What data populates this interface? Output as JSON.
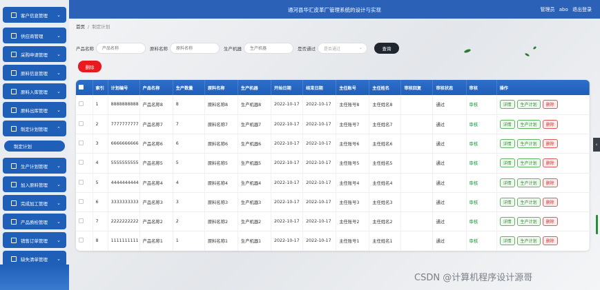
{
  "header": {
    "title": "通河县华汇皮革厂管理系统的设计与实现",
    "user_role": "管理员",
    "user_name": "abo",
    "logout_label": "退出登录"
  },
  "breadcrumb": {
    "home": "首页",
    "current": "制定计划"
  },
  "sidebar": {
    "items": [
      {
        "label": "客户信息管理",
        "icon": "table-icon",
        "expanded": false
      },
      {
        "label": "供应商管理",
        "icon": "user-icon",
        "expanded": false
      },
      {
        "label": "采购申请管理",
        "icon": "grid-icon",
        "expanded": false
      },
      {
        "label": "原料信息管理",
        "icon": "flag-icon",
        "expanded": false
      },
      {
        "label": "原料入库管理",
        "icon": "list-icon",
        "expanded": false
      },
      {
        "label": "原料出库管理",
        "icon": "card-icon",
        "expanded": false
      },
      {
        "label": "制定计划管理",
        "icon": "printer-icon",
        "expanded": true
      },
      {
        "label": "生产计划管理",
        "icon": "chart-icon",
        "expanded": false
      },
      {
        "label": "加入原料管理",
        "icon": "bar-icon",
        "expanded": false
      },
      {
        "label": "完成加工管理",
        "icon": "grid-icon",
        "expanded": false
      },
      {
        "label": "产品质检管理",
        "icon": "box-icon",
        "expanded": false
      },
      {
        "label": "销售订单管理",
        "icon": "grid-icon",
        "expanded": false
      },
      {
        "label": "缺失清单管理",
        "icon": "user-icon",
        "expanded": false
      }
    ],
    "active_sub": "制定计划"
  },
  "search": {
    "product_label": "产品名称",
    "product_placeholder": "产品名称",
    "material_label": "原料名称",
    "material_placeholder": "原料名称",
    "machine_label": "生产机器",
    "machine_placeholder": "生产机器",
    "pass_label": "是否通过",
    "pass_placeholder": "是否通过",
    "search_button": "查询"
  },
  "delete_button": "删除",
  "table": {
    "columns": [
      "",
      "索引",
      "计划编号",
      "产品名称",
      "生产数量",
      "原料名称",
      "生产机器",
      "开始日期",
      "结束日期",
      "主任账号",
      "主任姓名",
      "审核回复",
      "审核状态",
      "审核",
      "操作"
    ],
    "rows": [
      {
        "index": "1",
        "plan_no": "8888888888",
        "product": "产品名称8",
        "qty": "8",
        "material": "原料名称8",
        "machine": "生产机器8",
        "start": "2022-10-17",
        "end": "2022-10-17",
        "account": "主任账号8",
        "name": "主任姓名8",
        "reply": "",
        "status": "通过",
        "audit": "审核"
      },
      {
        "index": "2",
        "plan_no": "7777777777",
        "product": "产品名称7",
        "qty": "7",
        "material": "原料名称7",
        "machine": "生产机器7",
        "start": "2022-10-17",
        "end": "2022-10-17",
        "account": "主任账号7",
        "name": "主任姓名7",
        "reply": "",
        "status": "通过",
        "audit": "审核"
      },
      {
        "index": "3",
        "plan_no": "6666666666",
        "product": "产品名称6",
        "qty": "6",
        "material": "原料名称6",
        "machine": "生产机器6",
        "start": "2022-10-17",
        "end": "2022-10-17",
        "account": "主任账号6",
        "name": "主任姓名6",
        "reply": "",
        "status": "通过",
        "audit": "审核"
      },
      {
        "index": "4",
        "plan_no": "5555555555",
        "product": "产品名称5",
        "qty": "5",
        "material": "原料名称5",
        "machine": "生产机器5",
        "start": "2022-10-17",
        "end": "2022-10-17",
        "account": "主任账号5",
        "name": "主任姓名5",
        "reply": "",
        "status": "通过",
        "audit": "审核"
      },
      {
        "index": "5",
        "plan_no": "4444444444",
        "product": "产品名称4",
        "qty": "4",
        "material": "原料名称4",
        "machine": "生产机器4",
        "start": "2022-10-17",
        "end": "2022-10-17",
        "account": "主任账号4",
        "name": "主任姓名4",
        "reply": "",
        "status": "通过",
        "audit": "审核"
      },
      {
        "index": "6",
        "plan_no": "3333333333",
        "product": "产品名称3",
        "qty": "3",
        "material": "原料名称3",
        "machine": "生产机器3",
        "start": "2022-10-17",
        "end": "2022-10-17",
        "account": "主任账号3",
        "name": "主任姓名3",
        "reply": "",
        "status": "通过",
        "audit": "审核"
      },
      {
        "index": "7",
        "plan_no": "2222222222",
        "product": "产品名称2",
        "qty": "2",
        "material": "原料名称2",
        "machine": "生产机器2",
        "start": "2022-10-17",
        "end": "2022-10-17",
        "account": "主任账号2",
        "name": "主任姓名2",
        "reply": "",
        "status": "通过",
        "audit": "审核"
      },
      {
        "index": "8",
        "plan_no": "1111111111",
        "product": "产品名称1",
        "qty": "1",
        "material": "原料名称1",
        "machine": "生产机器1",
        "start": "2022-10-17",
        "end": "2022-10-17",
        "account": "主任账号1",
        "name": "主任姓名1",
        "reply": "",
        "status": "通过",
        "audit": "审核"
      }
    ],
    "ops": {
      "detail": "详情",
      "plan": "生产计划",
      "delete": "删除"
    }
  },
  "watermark": "CSDN @计算机程序设计源哥",
  "colors": {
    "header": "#2b62b7",
    "sidebar_item": "#1f5fb8",
    "delete": "#e8191f",
    "search_btn": "#1f2630",
    "audit_link": "#1a9a3a"
  }
}
